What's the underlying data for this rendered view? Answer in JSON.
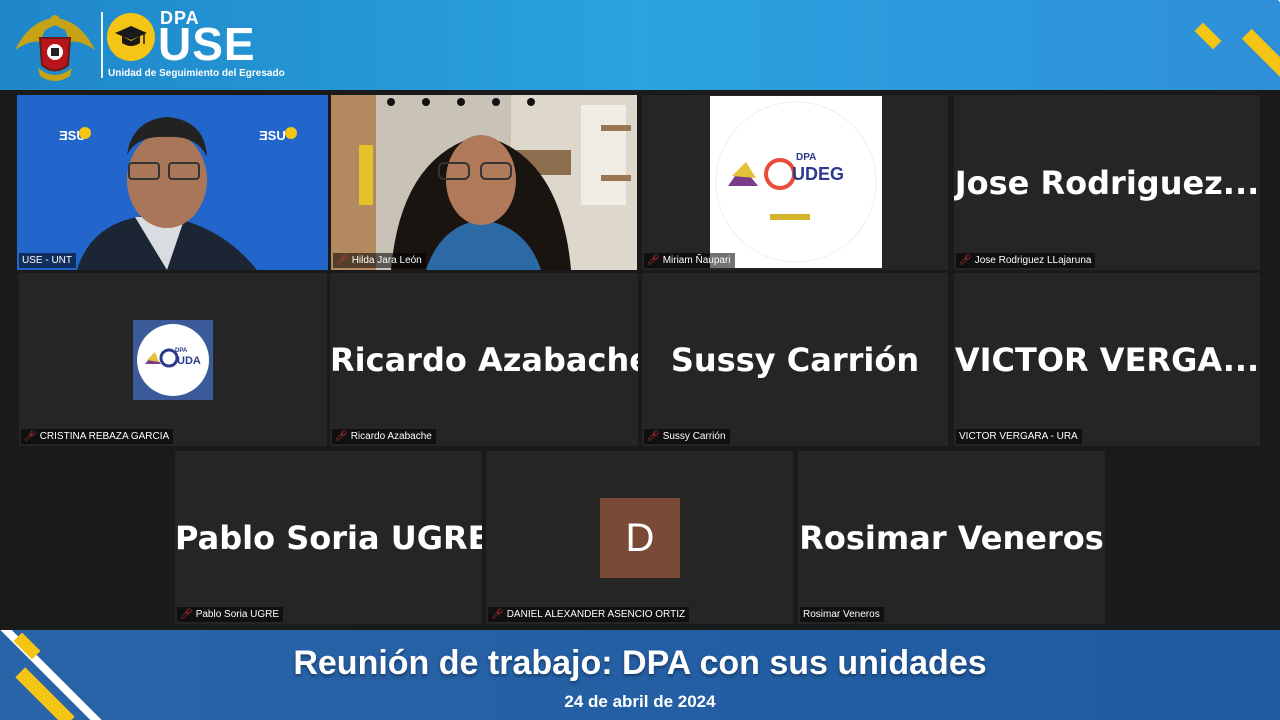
{
  "header": {
    "logo_dpa": "DPA",
    "logo_use": "USE",
    "logo_subtitle": "Unidad de Seguimiento del Egresado"
  },
  "tiles": [
    {
      "name_label": "USE - UNT",
      "muted": false,
      "active": true
    },
    {
      "name_label": "Hilda  Jara León",
      "muted": true
    },
    {
      "name_label": "Miriam Ñaupari",
      "muted": true
    },
    {
      "big_name": "Jose  Rodriguez...",
      "name_label": "Jose Rodriguez LLajaruna",
      "muted": true
    },
    {
      "name_label": "CRISTINA REBAZA GARCIA",
      "muted": true
    },
    {
      "big_name": "Ricardo Azabache",
      "name_label": "Ricardo Azabache",
      "muted": true
    },
    {
      "big_name": "Sussy Carrión",
      "name_label": "Sussy Carrión",
      "muted": true
    },
    {
      "big_name": "VICTOR  VERGA...",
      "name_label": "VICTOR VERGARA - URA",
      "muted": false
    },
    {
      "big_name": "Pablo Soria UGRE",
      "name_label": "Pablo Soria UGRE",
      "muted": true
    },
    {
      "avatar_letter": "D",
      "name_label": "DANIEL ALEXANDER ASENCIO ORTIZ",
      "muted": true
    },
    {
      "big_name": "Rosimar Veneros",
      "name_label": "Rosimar Veneros",
      "muted": false
    }
  ],
  "logos": {
    "udeg": "UDEG",
    "uda": "UDA",
    "dpa_small": "DPA",
    "use_small": "USE"
  },
  "footer": {
    "title": "Reunión de trabajo: DPA con sus unidades",
    "date": "24 de abril de 2024"
  },
  "colors": {
    "header_blue": "#2aa3e0",
    "footer_blue": "#2a64a8",
    "accent_yellow": "#f5c516",
    "active_speaker_border": "#c6e55a",
    "mic_off_red": "#e23b3b"
  }
}
